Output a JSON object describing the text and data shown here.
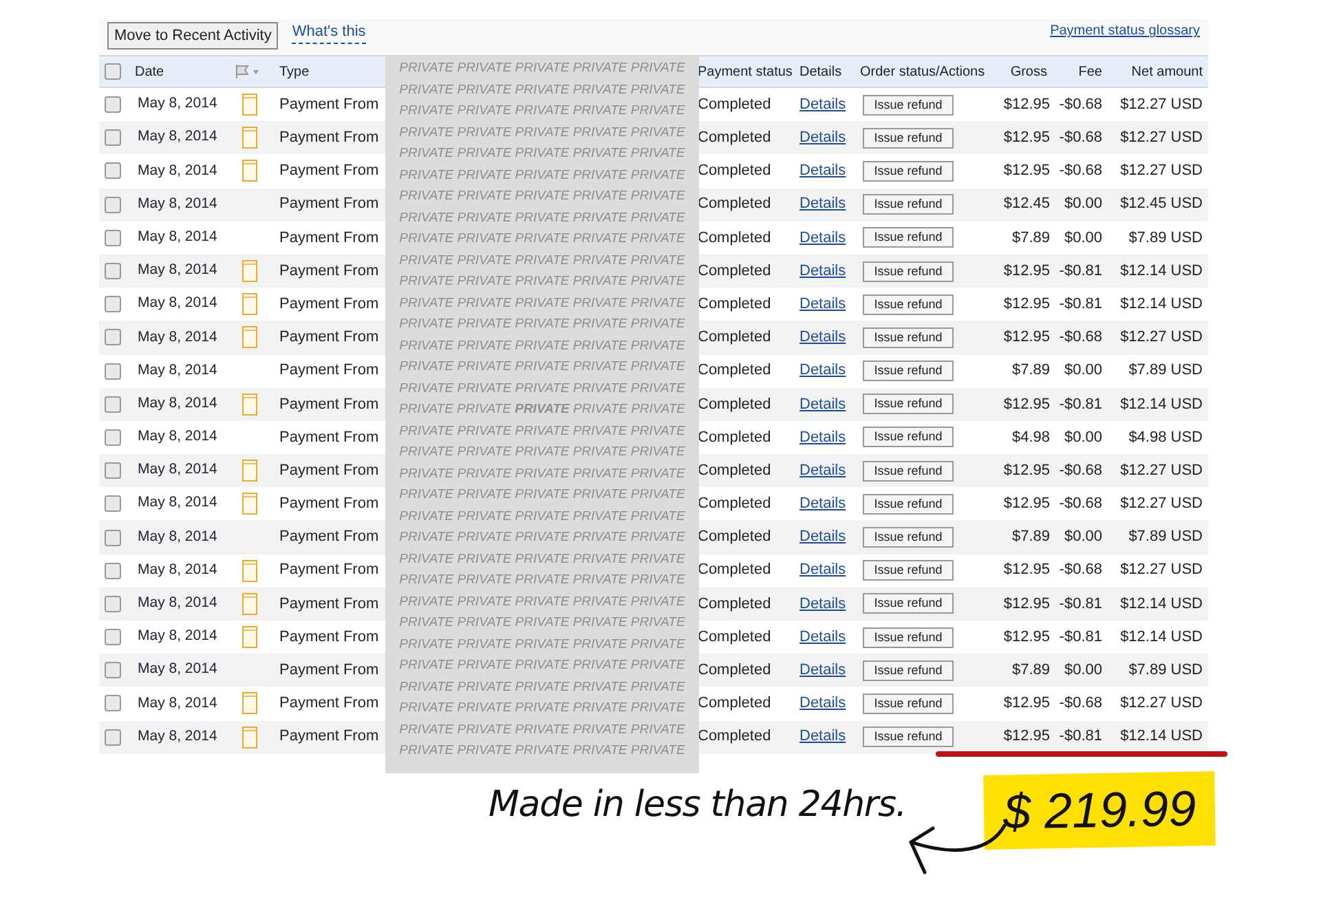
{
  "toolbar": {
    "button": "Move to Recent Activity",
    "help_link": "What's this",
    "glossary_link": "Payment status glossary"
  },
  "columns": [
    "Date",
    "Type",
    "Payment status",
    "Details",
    "Order status/Actions",
    "Gross",
    "Fee",
    "Net amount"
  ],
  "header_checkbox": {
    "checked": false
  },
  "rows": [
    {
      "checked": false,
      "date": "May 8, 2014",
      "note": true,
      "type": "Payment From",
      "status": "Completed",
      "details": "Details",
      "action": "Issue refund",
      "gross": "$12.95",
      "fee": "-$0.68",
      "net": "$12.27 USD"
    },
    {
      "checked": false,
      "date": "May 8, 2014",
      "note": true,
      "type": "Payment From",
      "status": "Completed",
      "details": "Details",
      "action": "Issue refund",
      "gross": "$12.95",
      "fee": "-$0.68",
      "net": "$12.27 USD"
    },
    {
      "checked": false,
      "date": "May 8, 2014",
      "note": true,
      "type": "Payment From",
      "status": "Completed",
      "details": "Details",
      "action": "Issue refund",
      "gross": "$12.95",
      "fee": "-$0.68",
      "net": "$12.27 USD"
    },
    {
      "checked": false,
      "date": "May 8, 2014",
      "note": false,
      "type": "Payment From",
      "status": "Completed",
      "details": "Details",
      "action": "Issue refund",
      "gross": "$12.45",
      "fee": "$0.00",
      "net": "$12.45 USD"
    },
    {
      "checked": false,
      "date": "May 8, 2014",
      "note": false,
      "type": "Payment From",
      "status": "Completed",
      "details": "Details",
      "action": "Issue refund",
      "gross": "$7.89",
      "fee": "$0.00",
      "net": "$7.89 USD"
    },
    {
      "checked": false,
      "date": "May 8, 2014",
      "note": true,
      "type": "Payment From",
      "status": "Completed",
      "details": "Details",
      "action": "Issue refund",
      "gross": "$12.95",
      "fee": "-$0.81",
      "net": "$12.14 USD"
    },
    {
      "checked": false,
      "date": "May 8, 2014",
      "note": true,
      "type": "Payment From",
      "status": "Completed",
      "details": "Details",
      "action": "Issue refund",
      "gross": "$12.95",
      "fee": "-$0.81",
      "net": "$12.14 USD"
    },
    {
      "checked": false,
      "date": "May 8, 2014",
      "note": true,
      "type": "Payment From",
      "status": "Completed",
      "details": "Details",
      "action": "Issue refund",
      "gross": "$12.95",
      "fee": "-$0.68",
      "net": "$12.27 USD"
    },
    {
      "checked": false,
      "date": "May 8, 2014",
      "note": false,
      "type": "Payment From",
      "status": "Completed",
      "details": "Details",
      "action": "Issue refund",
      "gross": "$7.89",
      "fee": "$0.00",
      "net": "$7.89 USD"
    },
    {
      "checked": false,
      "date": "May 8, 2014",
      "note": true,
      "type": "Payment From",
      "status": "Completed",
      "details": "Details",
      "action": "Issue refund",
      "gross": "$12.95",
      "fee": "-$0.81",
      "net": "$12.14 USD"
    },
    {
      "checked": false,
      "date": "May 8, 2014",
      "note": false,
      "type": "Payment From",
      "status": "Completed",
      "details": "Details",
      "action": "Issue refund",
      "gross": "$4.98",
      "fee": "$0.00",
      "net": "$4.98 USD"
    },
    {
      "checked": false,
      "date": "May 8, 2014",
      "note": true,
      "type": "Payment From",
      "status": "Completed",
      "details": "Details",
      "action": "Issue refund",
      "gross": "$12.95",
      "fee": "-$0.68",
      "net": "$12.27 USD"
    },
    {
      "checked": false,
      "date": "May 8, 2014",
      "note": true,
      "type": "Payment From",
      "status": "Completed",
      "details": "Details",
      "action": "Issue refund",
      "gross": "$12.95",
      "fee": "-$0.68",
      "net": "$12.27 USD"
    },
    {
      "checked": false,
      "date": "May 8, 2014",
      "note": false,
      "type": "Payment From",
      "status": "Completed",
      "details": "Details",
      "action": "Issue refund",
      "gross": "$7.89",
      "fee": "$0.00",
      "net": "$7.89 USD"
    },
    {
      "checked": false,
      "date": "May 8, 2014",
      "note": true,
      "type": "Payment From",
      "status": "Completed",
      "details": "Details",
      "action": "Issue refund",
      "gross": "$12.95",
      "fee": "-$0.68",
      "net": "$12.27 USD"
    },
    {
      "checked": false,
      "date": "May 8, 2014",
      "note": true,
      "type": "Payment From",
      "status": "Completed",
      "details": "Details",
      "action": "Issue refund",
      "gross": "$12.95",
      "fee": "-$0.81",
      "net": "$12.14 USD"
    },
    {
      "checked": false,
      "date": "May 8, 2014",
      "note": true,
      "type": "Payment From",
      "status": "Completed",
      "details": "Details",
      "action": "Issue refund",
      "gross": "$12.95",
      "fee": "-$0.81",
      "net": "$12.14 USD"
    },
    {
      "checked": false,
      "date": "May 8, 2014",
      "note": false,
      "type": "Payment From",
      "status": "Completed",
      "details": "Details",
      "action": "Issue refund",
      "gross": "$7.89",
      "fee": "$0.00",
      "net": "$7.89 USD"
    },
    {
      "checked": false,
      "date": "May 8, 2014",
      "note": true,
      "type": "Payment From",
      "status": "Completed",
      "details": "Details",
      "action": "Issue refund",
      "gross": "$12.95",
      "fee": "-$0.68",
      "net": "$12.27 USD"
    },
    {
      "checked": false,
      "date": "May 8, 2014",
      "note": true,
      "type": "Payment From",
      "status": "Completed",
      "details": "Details",
      "action": "Issue refund",
      "gross": "$12.95",
      "fee": "-$0.81",
      "net": "$12.14 USD"
    }
  ],
  "redaction_lines": [
    "PRIVATE PRIVATE PRIVATE PRIVATE PRIVATE",
    "PRIVATE PRIVATE PRIVATE PRIVATE PRIVATE",
    "PRIVATE PRIVATE PRIVATE PRIVATE PRIVATE",
    "PRIVATE PRIVATE PRIVATE PRIVATE PRIVATE",
    "PRIVATE PRIVATE PRIVATE PRIVATE PRIVATE",
    "PRIVATE PRIVATE PRIVATE PRIVATE PRIVATE",
    "PRIVATE PRIVATE PRIVATE PRIVATE PRIVATE",
    "PRIVATE PRIVATE PRIVATE PRIVATE PRIVATE",
    "PRIVATE PRIVATE PRIVATE PRIVATE PRIVATE",
    "PRIVATE PRIVATE PRIVATE PRIVATE PRIVATE",
    "PRIVATE PRIVATE PRIVATE PRIVATE PRIVATE",
    "PRIVATE PRIVATE PRIVATE PRIVATE PRIVATE",
    "PRIVATE PRIVATE PRIVATE PRIVATE PRIVATE",
    "PRIVATE PRIVATE PRIVATE PRIVATE PRIVATE",
    "PRIVATE PRIVATE PRIVATE PRIVATE PRIVATE",
    "PRIVATE PRIVATE PRIVATE PRIVATE PRIVATE",
    "PRIVATE PRIVATE **PRIVATE** PRIVATE PRIVATE",
    "PRIVATE PRIVATE PRIVATE PRIVATE PRIVATE",
    "PRIVATE PRIVATE PRIVATE PRIVATE PRIVATE",
    "PRIVATE PRIVATE PRIVATE PRIVATE PRIVATE",
    "PRIVATE PRIVATE PRIVATE PRIVATE PRIVATE",
    "PRIVATE PRIVATE PRIVATE PRIVATE PRIVATE",
    "PRIVATE PRIVATE PRIVATE PRIVATE PRIVATE",
    "PRIVATE PRIVATE PRIVATE PRIVATE PRIVATE",
    "PRIVATE PRIVATE PRIVATE PRIVATE PRIVATE",
    "PRIVATE PRIVATE PRIVATE PRIVATE PRIVATE",
    "PRIVATE PRIVATE PRIVATE PRIVATE PRIVATE",
    "PRIVATE PRIVATE PRIVATE PRIVATE PRIVATE",
    "PRIVATE PRIVATE PRIVATE PRIVATE PRIVATE",
    "PRIVATE PRIVATE PRIVATE PRIVATE PRIVATE",
    "PRIVATE PRIVATE PRIVATE PRIVATE PRIVATE",
    "PRIVATE PRIVATE PRIVATE PRIVATE PRIVATE",
    "PRIVATE PRIVATE PRIVATE PRIVATE PRIVATE"
  ],
  "annotation": {
    "caption": "Made in less than 24hrs.",
    "price": "$ 219.99"
  }
}
